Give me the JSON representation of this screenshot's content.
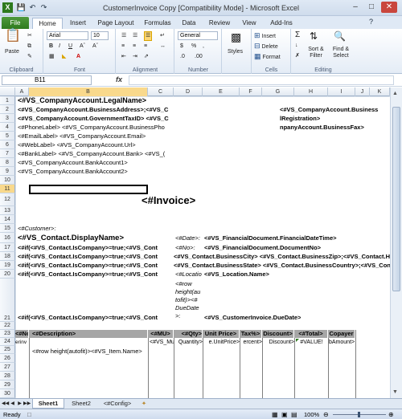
{
  "window": {
    "title": "CustomerInvoice Copy  [Compatibility Mode]  -  Microsoft Excel"
  },
  "ribbon_tabs": [
    "File",
    "Home",
    "Insert",
    "Page Layout",
    "Formulas",
    "Data",
    "Review",
    "View",
    "Add-Ins"
  ],
  "ribbon": {
    "paste": "Paste",
    "font_name": "Arial",
    "font_size": "10",
    "number_format": "General",
    "styles": "Styles",
    "insert": "Insert",
    "delete": "Delete",
    "format": "Format",
    "sort_filter": "Sort & Filter",
    "find_select": "Find & Select",
    "groups": [
      "Clipboard",
      "Font",
      "Alignment",
      "Number",
      "Cells",
      "Editing"
    ]
  },
  "formula_bar": {
    "name_box": "B11",
    "fx": "fx",
    "formula": ""
  },
  "columns": [
    "A",
    "B",
    "C",
    "D",
    "E",
    "F",
    "G",
    "H",
    "I",
    "J",
    "K"
  ],
  "rows": [
    "1",
    "2",
    "3",
    "4",
    "5",
    "6",
    "7",
    "8",
    "9",
    "10",
    "11",
    "12",
    "13",
    "14",
    "15",
    "16",
    "17",
    "18",
    "19",
    "20",
    "21",
    "22",
    "23",
    "24",
    "25",
    "26",
    "27",
    "28",
    "29",
    "30",
    "31",
    "32",
    "33"
  ],
  "cells": {
    "r1": "<#VS_CompanyAccount.LegalName>",
    "r2": "<#VS_CompanyAccount.BusinessAddress>;<#VS_C",
    "r2b": "<#VS_CompanyAccount.Business",
    "r3": "<#VS_CompanyAccount.GovernmentTaxID>  <#VS_C",
    "r3b": "lRegistration>",
    "r4": "<#PhoneLabel>  <#VS_CompanyAccount.BusinessPho",
    "r4b": "npanyAccount.BusinessFax>",
    "r5": "<#EmailLabel>  <#VS_CompanyAccount.Email>",
    "r6": "<#WebLabel>  <#VS_CompanyAccount.Url>",
    "r7": "<#BankLabel>  <#VS_CompanyAccount.Bank>  <#VS_(",
    "r8": "<#VS_CompanyAccount.BankAccount1>",
    "r9": "<#VS_CompanyAccount.BankAccount2>",
    "r12": "<#Invoice>",
    "r15": "<#Customer>:",
    "r16": "<#VS_Contact.DisplayName>",
    "r16d": "<#Date>:",
    "r16e": "<#VS_FinancialDocument.FinancialDateTime>",
    "r17": "<#if(<#VS_Contact.IsCompany>=true;<#VS_Cont",
    "r17d": "<#No>:",
    "r17e": "<#VS_FinancialDocument.DocumentNo>",
    "r18": "<#if(<#VS_Contact.IsCompany>=true;<#VS_Cont",
    "r18e": "<#VS_Contact.BusinessCity>  <#VS_Contact.BusinessZip>;<#VS_Contact.HomeC",
    "r19": "<#if(<#VS_Contact.IsCompany>=true;<#VS_Cont",
    "r19e": "<#VS_Contact.BusinessState>  <#VS_Contact.BusinessCountry>;<#VS_Contact.Ho",
    "r20": "<#if(<#VS_Contact.IsCompany>=true;<#VS_Cont",
    "r20d": "<#Locatio",
    "r20e": "<#VS_Location.Name>",
    "r20note": [
      "<#row",
      "height(au",
      "tofit)><#",
      "DueDate",
      ">:"
    ],
    "r21": "<#if(<#VS_Contact.IsCompany>=true;<#VS_Cont",
    "r21e": "<#VS_CustomerInvoice.DueDate>",
    "r23": [
      "<#No>",
      "<#Description>",
      "<#MU>",
      "<#Qty>",
      "Unit Price>",
      "Tax%>",
      "Discount>",
      "<#Total>",
      "Copayer"
    ],
    "r26": [
      "<#VS_Item.TaxPercent>",
      "<#row height(autofit)><#VS_Item.Name>",
      "<#VS_Mu",
      "Quantity>",
      "e.UnitPrice>",
      "ercent>",
      "Discount>",
      "#VALUE!",
      "bAmount>"
    ],
    "r26a": "erinv"
  },
  "sheet_tabs": [
    "Sheet1",
    "Sheet2",
    "<#Config>"
  ],
  "status": {
    "ready": "Ready",
    "zoom": "100%"
  }
}
